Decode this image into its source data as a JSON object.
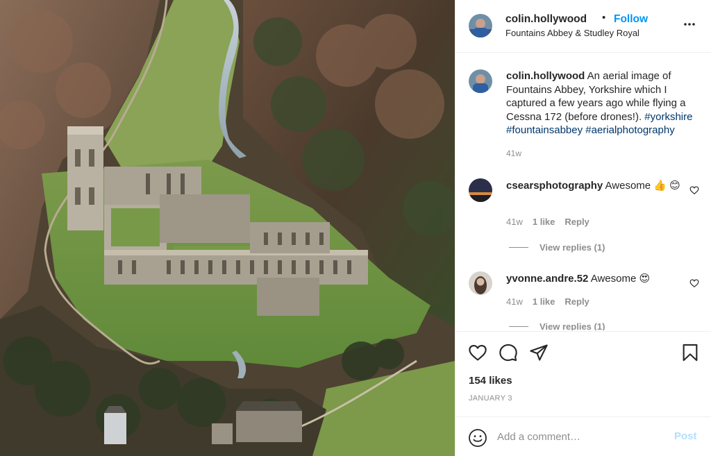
{
  "post": {
    "username": "colin.hollywood",
    "follow_label": "Follow",
    "dot": "•",
    "location": "Fountains Abbey & Studley Royal"
  },
  "caption": {
    "username": "colin.hollywood",
    "text": " An aerial image of Fountains Abbey, Yorkshire which I captured a few years ago while flying a Cessna 172 (before drones!). ",
    "hashtags": [
      "#yorkshire",
      "#fountainsabbey",
      "#aerialphotography"
    ],
    "time": "41w"
  },
  "comments": [
    {
      "username": "csearsphotography",
      "text": " Awesome 👍 😊",
      "time": "41w",
      "likes": "1 like",
      "reply_label": "Reply",
      "view_replies": "View replies (1)"
    },
    {
      "username": "yvonne.andre.52",
      "text": " Awesome 😍",
      "time": "41w",
      "likes": "1 like",
      "reply_label": "Reply",
      "view_replies": "View replies (1)"
    }
  ],
  "actions": {
    "likes": "154 likes",
    "date": "JANUARY 3",
    "icons": [
      "heart-icon",
      "comment-icon",
      "share-icon",
      "bookmark-icon"
    ]
  },
  "add_comment": {
    "placeholder": "Add a comment…",
    "post_label": "Post"
  },
  "colors": {
    "follow": "#0095f6",
    "hashtag": "#00376b",
    "post_disabled": "#b2dffc",
    "muted": "#8e8e8e"
  }
}
